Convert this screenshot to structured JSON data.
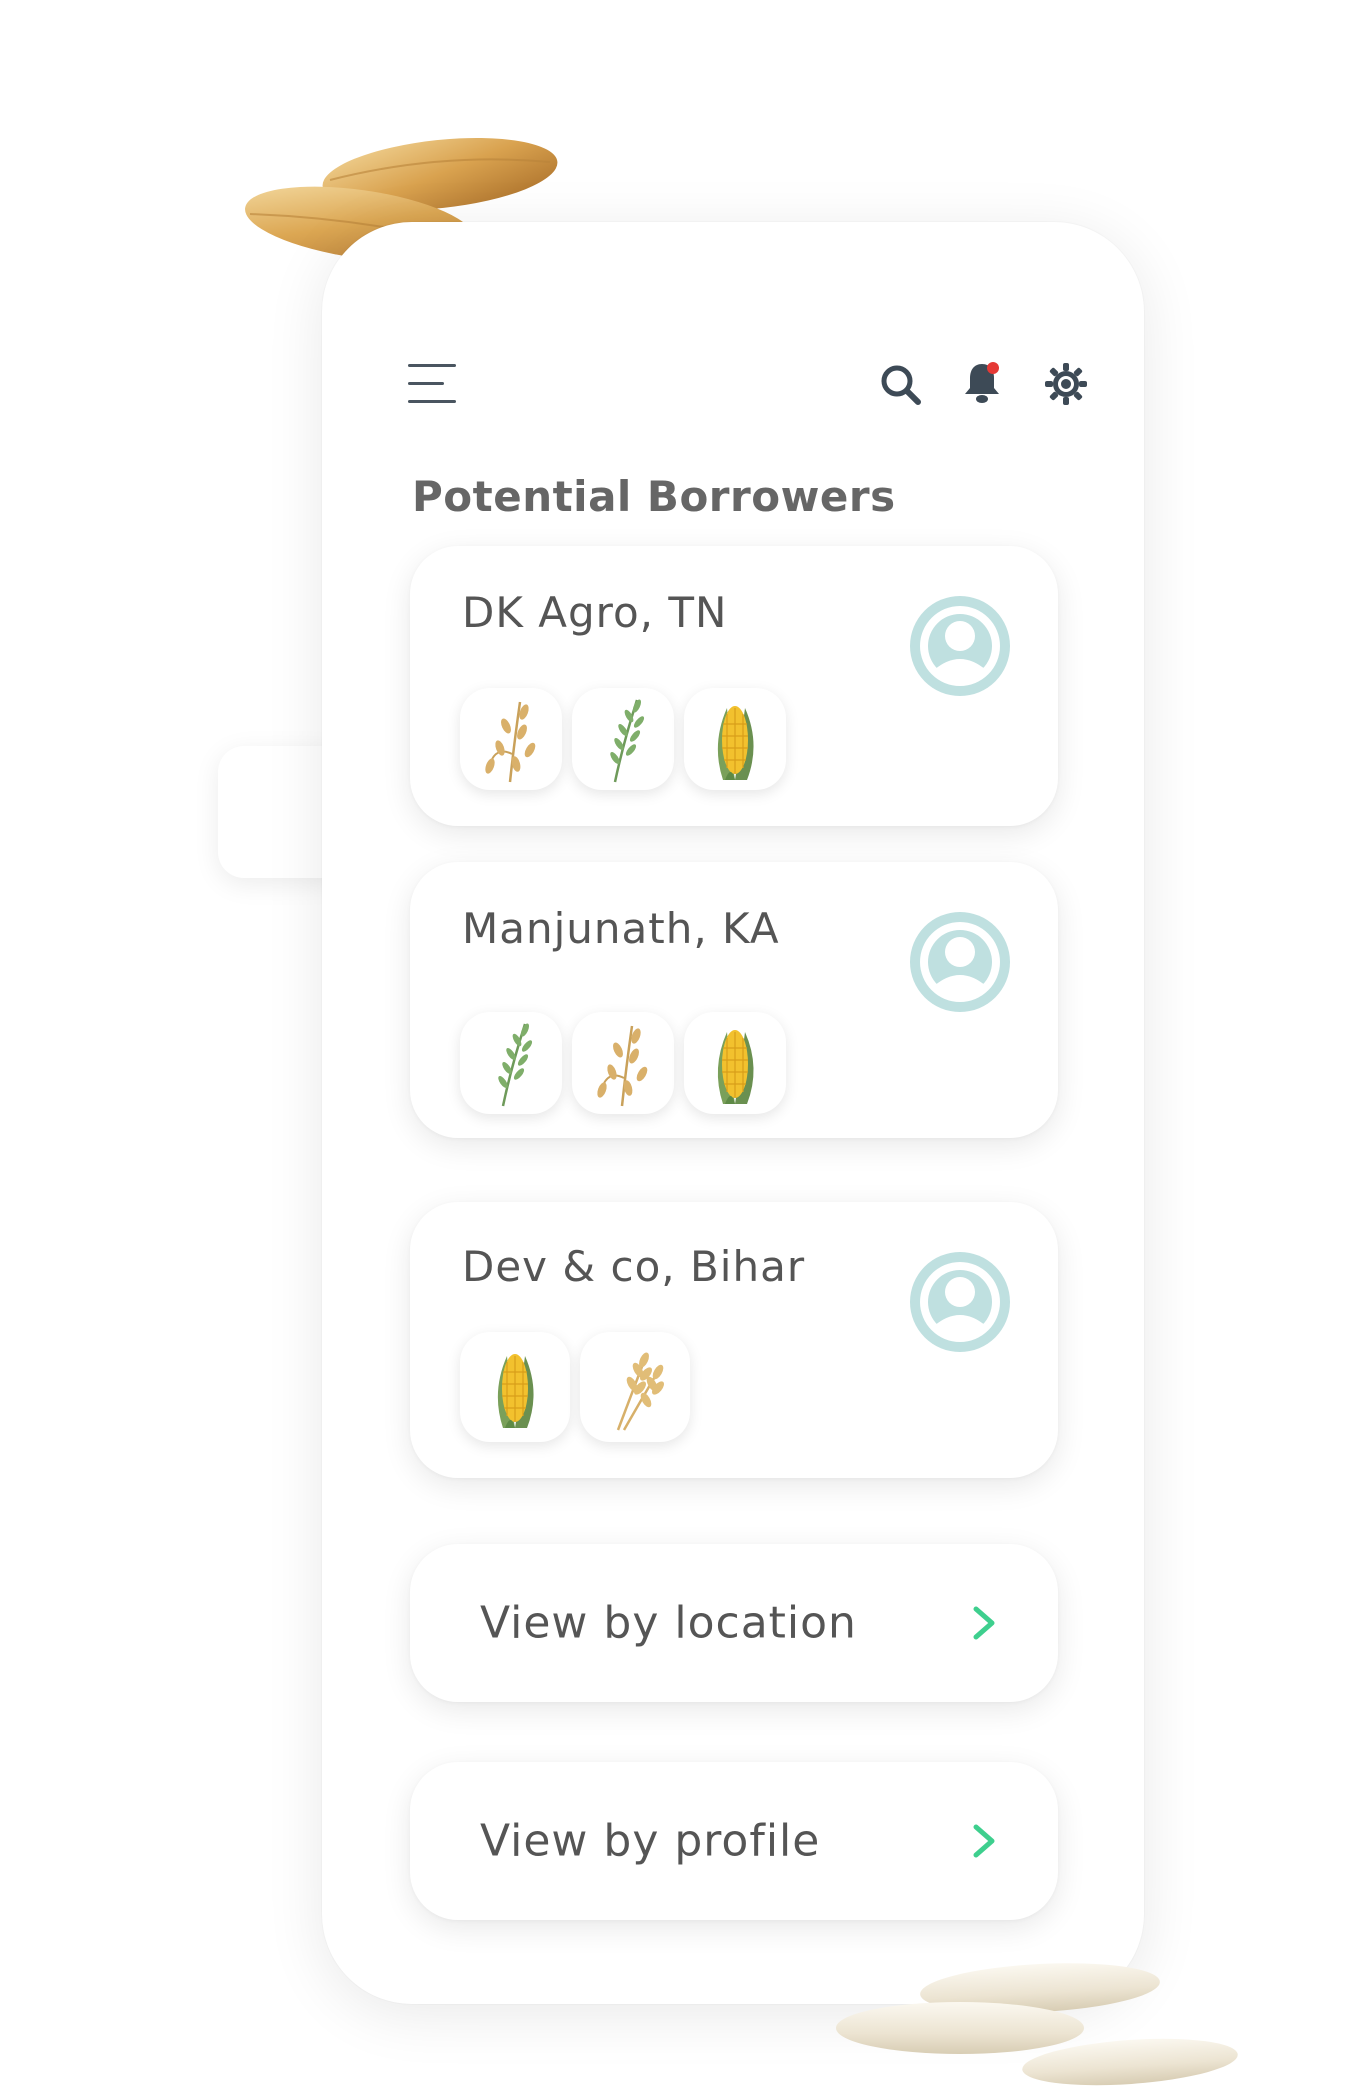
{
  "app": {
    "title": "Potential Borrowers"
  },
  "header": {
    "menu_icon": "hamburger-menu-icon",
    "icons": [
      "search-icon",
      "bell-icon",
      "gear-icon"
    ],
    "notification_dot_color": "#e53935"
  },
  "borrowers": [
    {
      "name": "DK Agro, TN",
      "avatar_icon": "user-avatar-icon",
      "crops": [
        "oat",
        "millet",
        "corn"
      ]
    },
    {
      "name": "Manjunath, KA",
      "avatar_icon": "user-avatar-icon",
      "crops": [
        "millet",
        "oat",
        "corn"
      ]
    },
    {
      "name": "Dev & co, Bihar",
      "avatar_icon": "user-avatar-icon",
      "crops": [
        "corn",
        "wheat"
      ]
    }
  ],
  "nav": {
    "location_label": "View by location",
    "profile_label": "View by profile"
  },
  "colors": {
    "accent_chevron": "#3ecf8e",
    "avatar_bg": "#bfe0e0",
    "icon_dark": "#3d4a56"
  }
}
